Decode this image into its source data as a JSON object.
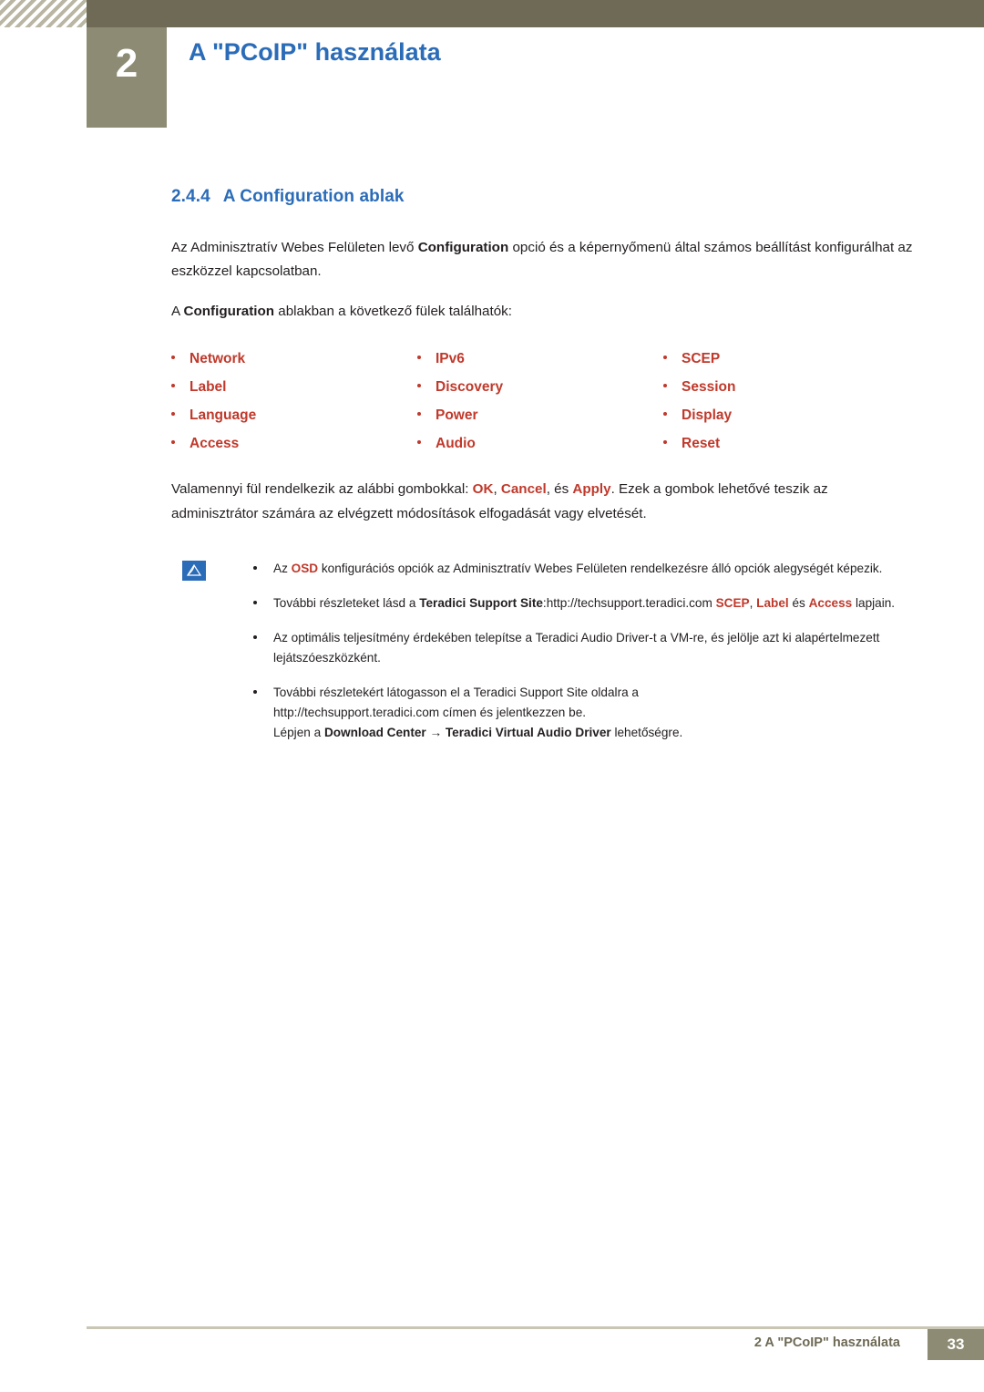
{
  "header": {
    "chapter_number": "2",
    "chapter_title": "A \"PCoIP\" használata"
  },
  "section": {
    "number": "2.4.4",
    "title": "A Configuration ablak"
  },
  "paragraphs": {
    "p1_a": "Az Adminisztratív Webes Felületen levő ",
    "p1_kw": "Configuration",
    "p1_b": " opció és a képernyőmenü által számos beállítást konfigurálhat az eszközzel kapcsolatban.",
    "p2_a": "A ",
    "p2_kw": "Configuration",
    "p2_b": " ablakban a következő fülek találhatók:",
    "p3_a": "Valamennyi fül rendelkezik az alábbi gombokkal: ",
    "p3_ok": "OK",
    "p3_sep1": ", ",
    "p3_cancel": "Cancel",
    "p3_sep2": ", és ",
    "p3_apply": "Apply",
    "p3_b": ". Ezek a gombok lehetővé teszik az adminisztrátor számára az elvégzett módosítások elfogadását vagy elvetését."
  },
  "tabs": [
    "Network",
    "IPv6",
    "SCEP",
    "Label",
    "Discovery",
    "Session",
    "Language",
    "Power",
    "Display",
    "Access",
    "Audio",
    "Reset"
  ],
  "notes": {
    "icon_name": "note-icon",
    "items": [
      {
        "a": "Az ",
        "kw1": "OSD",
        "b": " konfigurációs opciók az Adminisztratív Webes Felületen rendelkezésre álló opciók alegységét képezik."
      },
      {
        "a": "További részleteket lásd a ",
        "bold1": "Teradici Support Site",
        "mid": ":http://techsupport.teradici.com ",
        "kw1": "SCEP",
        "sep": ", ",
        "kw2": "Label",
        "c": " és ",
        "kw3": "Access",
        "d": " lapjain."
      },
      {
        "a": "Az optimális teljesítmény érdekében telepítse a Teradici Audio Driver-t a VM-re, és jelölje azt ki alapértelmezett lejátszóeszközként."
      },
      {
        "a": "További részletekért látogasson el a Teradici Support Site oldalra a",
        "b": "http://techsupport.teradici.com címen és jelentkezzen be.",
        "c_a": "Lépjen a ",
        "c_bold1": "Download Center",
        "c_arrow": " → ",
        "c_bold2": "Teradici Virtual Audio Driver",
        "c_b": " lehetőségre."
      }
    ]
  },
  "footer": {
    "text": "2 A \"PCoIP\" használata",
    "page": "33"
  },
  "colors": {
    "accent_blue": "#2b6cb8",
    "keyword_red": "#c0392b",
    "header_bar": "#6e6a55",
    "chapter_box": "#8e8b74"
  }
}
